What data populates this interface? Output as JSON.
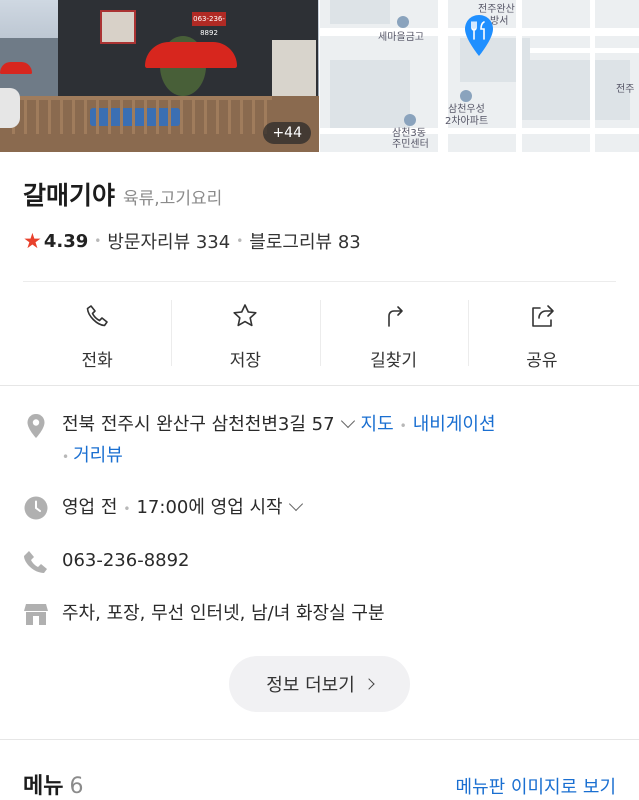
{
  "hero": {
    "photo_count": "+44",
    "photo_sign_text": "063-236-8892",
    "map_labels": [
      "세마을금고",
      "전주완산",
      "방서",
      "삼천우성",
      "2차아파트",
      "삼천3동",
      "주민센터",
      "전주"
    ]
  },
  "place": {
    "name": "갈매기야",
    "category": "육류,고기요리",
    "rating": "4.39",
    "visitor_reviews": "방문자리뷰 334",
    "blog_reviews": "블로그리뷰 83"
  },
  "actions": [
    {
      "label": "전화",
      "icon": "phone-icon"
    },
    {
      "label": "저장",
      "icon": "star-outline-icon"
    },
    {
      "label": "길찾기",
      "icon": "directions-icon"
    },
    {
      "label": "공유",
      "icon": "share-icon"
    }
  ],
  "info": {
    "address": "전북 전주시 완산구 삼천천변3길 57",
    "map_link": "지도",
    "navigation_link": "내비게이션",
    "street_view_link": "거리뷰",
    "status": "영업 전",
    "hours_text": "17:00에 영업 시작",
    "phone": "063-236-8892",
    "amenities": "주차, 포장, 무선 인터넷, 남/녀 화장실 구분"
  },
  "more_button": "정보 더보기",
  "menu": {
    "title": "메뉴",
    "count": "6",
    "image_link": "메뉴판 이미지로 보기"
  },
  "colors": {
    "accent_link": "#1a6fd1",
    "star": "#e8412c",
    "pin": "#1f8fff"
  }
}
